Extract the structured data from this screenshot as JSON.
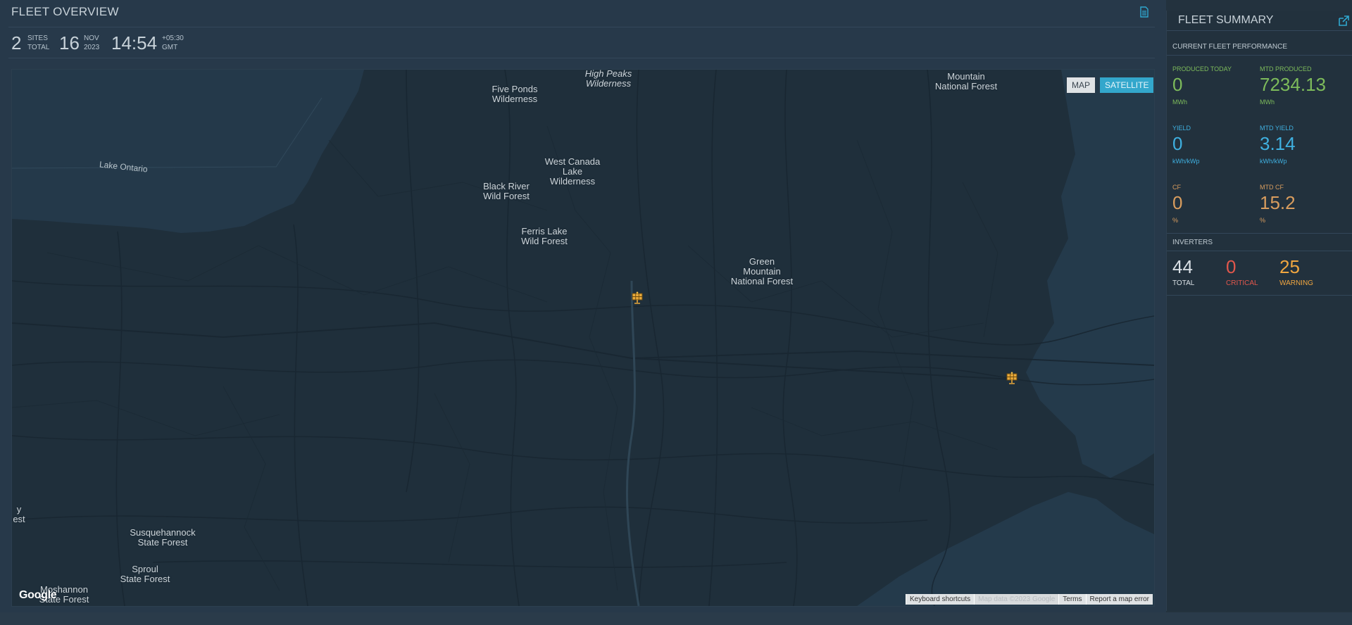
{
  "header": {
    "title": "FLEET OVERVIEW",
    "sites_count": "2",
    "sites_label_1": "SITES",
    "sites_label_2": "TOTAL",
    "day": "16",
    "month": "NOV",
    "year": "2023",
    "time": "14:54",
    "tz_offset": "+05:30",
    "tz_name": "GMT"
  },
  "map": {
    "controls": {
      "map": "MAP",
      "satellite": "SATELLITE"
    },
    "labels": [
      {
        "id": "high-peaks",
        "text": "High Peaks\nWilderness",
        "italic": true
      },
      {
        "id": "five-ponds",
        "text": "Five Ponds\nWilderness",
        "italic": false
      },
      {
        "id": "mountain-nf",
        "text": "Mountain\nNational Forest",
        "italic": false
      },
      {
        "id": "west-canada",
        "text": "West Canada\nLake\nWilderness",
        "italic": false
      },
      {
        "id": "black-river",
        "text": "Black River\nWild Forest",
        "italic": false
      },
      {
        "id": "ferris-lake",
        "text": "Ferris Lake\nWild Forest",
        "italic": false
      },
      {
        "id": "green-mountain",
        "text": "Green\nMountain\nNational Forest",
        "italic": false
      },
      {
        "id": "susquehannock",
        "text": "Susquehannock\nState Forest",
        "italic": false
      },
      {
        "id": "sproul",
        "text": "Sproul\nState Forest",
        "italic": false
      },
      {
        "id": "moshannon",
        "text": "Moshannon\nState Forest",
        "italic": false
      },
      {
        "id": "est",
        "text": "y\nest",
        "italic": false
      }
    ],
    "lake_label": "Lake Ontario",
    "google_logo": "Google",
    "attribution": {
      "shortcuts": "Keyboard shortcuts",
      "data": "Map data ©2023 Google",
      "terms": "Terms",
      "report": "Report a map error"
    },
    "markers": [
      {
        "name": "site-marker-1",
        "icon": "solar-panel-icon"
      },
      {
        "name": "site-marker-2",
        "icon": "solar-panel-icon"
      }
    ]
  },
  "summary": {
    "title": "FLEET SUMMARY",
    "section_performance": "CURRENT FLEET PERFORMANCE",
    "kpis": {
      "produced_today": {
        "label": "PRODUCED TODAY",
        "value": "0",
        "unit": "MWh"
      },
      "mtd_produced": {
        "label": "MTD PRODUCED",
        "value": "7234.13",
        "unit": "MWh"
      },
      "yield": {
        "label": "YIELD",
        "value": "0",
        "unit": "kWh/kWp"
      },
      "mtd_yield": {
        "label": "MTD YIELD",
        "value": "3.14",
        "unit": "kWh/kWp"
      },
      "cf": {
        "label": "CF",
        "value": "0",
        "unit": "%"
      },
      "mtd_cf": {
        "label": "MTD CF",
        "value": "15.2",
        "unit": "%"
      }
    },
    "section_inverters": "INVERTERS",
    "inverters": {
      "total": {
        "value": "44",
        "label": "TOTAL"
      },
      "critical": {
        "value": "0",
        "label": "CRITICAL"
      },
      "warning": {
        "value": "25",
        "label": "WARNING"
      }
    },
    "colors": {
      "produced": "#7dbb5b",
      "yield": "#3fb0e0",
      "cf": "#d99d5e",
      "critical": "#e2574c",
      "warning": "#f0a640"
    }
  }
}
